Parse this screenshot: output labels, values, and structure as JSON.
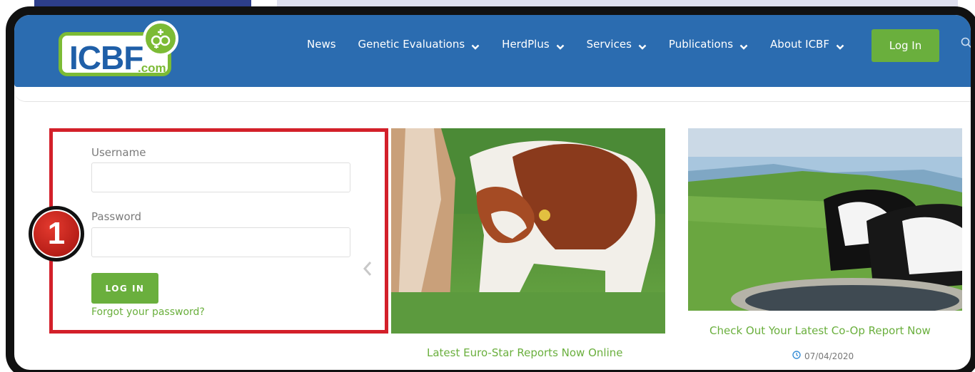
{
  "logo": {
    "main": "ICBF",
    "suffix": ".com"
  },
  "nav": {
    "items": [
      {
        "label": "News",
        "has_dropdown": false
      },
      {
        "label": "Genetic Evaluations",
        "has_dropdown": true
      },
      {
        "label": "HerdPlus",
        "has_dropdown": true
      },
      {
        "label": "Services",
        "has_dropdown": true
      },
      {
        "label": "Publications",
        "has_dropdown": true
      },
      {
        "label": "About ICBF",
        "has_dropdown": true
      }
    ],
    "login_label": "Log In",
    "search_icon": "search-icon"
  },
  "login_form": {
    "username_label": "Username",
    "username_value": "",
    "password_label": "Password",
    "password_value": "",
    "submit_label": "LOG IN",
    "forgot_label": "Forgot your password?"
  },
  "annotation": {
    "step_number": "1"
  },
  "articles": [
    {
      "title": "Latest Euro-Star Reports Now Online"
    },
    {
      "title": "Check Out Your Latest Co-Op Report Now",
      "date": "07/04/2020"
    }
  ],
  "colors": {
    "header": "#2b6cb0",
    "accent_green": "#6aaf3d",
    "highlight_red": "#d3202a"
  }
}
